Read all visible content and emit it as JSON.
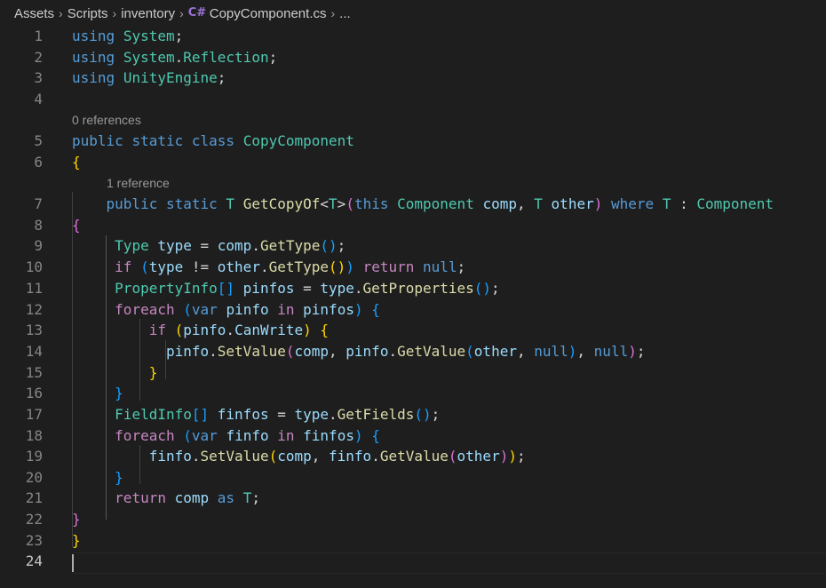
{
  "breadcrumb": {
    "items": [
      "Assets",
      "Scripts",
      "inventory"
    ],
    "file_icon": "C#",
    "file": "CopyComponent.cs",
    "tail": "..."
  },
  "icons": {
    "separator": "chevron-right-icon",
    "file": "csharp-file-icon"
  },
  "colors": {
    "background": "#1e1e1e",
    "keyword_control": "#c586c0",
    "keyword": "#569cd6",
    "type": "#4ec9b0",
    "method": "#dcdcaa",
    "variable": "#9cdcfe",
    "line_number": "#858585"
  },
  "codelens": {
    "class": "0 references",
    "method": "1 reference"
  },
  "active_line": "24",
  "lines": [
    {
      "n": "1",
      "tokens": [
        [
          "kb",
          "using"
        ],
        [
          "pn",
          " "
        ],
        [
          "ty",
          "System"
        ],
        [
          "pn",
          ";"
        ]
      ]
    },
    {
      "n": "2",
      "tokens": [
        [
          "kb",
          "using"
        ],
        [
          "pn",
          " "
        ],
        [
          "ty",
          "System"
        ],
        [
          "pn",
          "."
        ],
        [
          "ty",
          "Reflection"
        ],
        [
          "pn",
          ";"
        ]
      ]
    },
    {
      "n": "3",
      "tokens": [
        [
          "kb",
          "using"
        ],
        [
          "pn",
          " "
        ],
        [
          "ty",
          "UnityEngine"
        ],
        [
          "pn",
          ";"
        ]
      ]
    },
    {
      "n": "4",
      "tokens": []
    },
    {
      "n": "5",
      "tokens": [
        [
          "kb",
          "public"
        ],
        [
          "pn",
          " "
        ],
        [
          "kb",
          "static"
        ],
        [
          "pn",
          " "
        ],
        [
          "kb",
          "class"
        ],
        [
          "pn",
          " "
        ],
        [
          "ty",
          "CopyComponent"
        ]
      ]
    },
    {
      "n": "6",
      "tokens": [
        [
          "br1",
          "{"
        ]
      ]
    },
    {
      "n": "7",
      "tokens": [
        [
          "pn",
          "    "
        ],
        [
          "kb",
          "public"
        ],
        [
          "pn",
          " "
        ],
        [
          "kb",
          "static"
        ],
        [
          "pn",
          " "
        ],
        [
          "ty",
          "T"
        ],
        [
          "pn",
          " "
        ],
        [
          "fn",
          "GetCopyOf"
        ],
        [
          "pn",
          "<"
        ],
        [
          "ty",
          "T"
        ],
        [
          "pn",
          ">"
        ],
        [
          "br2",
          "("
        ],
        [
          "kb",
          "this"
        ],
        [
          "pn",
          " "
        ],
        [
          "ty",
          "Component"
        ],
        [
          "pn",
          " "
        ],
        [
          "vr",
          "comp"
        ],
        [
          "pn",
          ", "
        ],
        [
          "ty",
          "T"
        ],
        [
          "pn",
          " "
        ],
        [
          "vr",
          "other"
        ],
        [
          "br2",
          ")"
        ],
        [
          "pn",
          " "
        ],
        [
          "kb",
          "where"
        ],
        [
          "pn",
          " "
        ],
        [
          "ty",
          "T"
        ],
        [
          "pn",
          " : "
        ],
        [
          "ty",
          "Component"
        ]
      ]
    },
    {
      "n": "8",
      "tokens": [
        [
          "br2",
          "{"
        ]
      ]
    },
    {
      "n": "9",
      "tokens": [
        [
          "pn",
          "     "
        ],
        [
          "ty",
          "Type"
        ],
        [
          "pn",
          " "
        ],
        [
          "vr",
          "type"
        ],
        [
          "pn",
          " = "
        ],
        [
          "vr",
          "comp"
        ],
        [
          "pn",
          "."
        ],
        [
          "fn",
          "GetType"
        ],
        [
          "br3",
          "()"
        ],
        [
          "pn",
          ";"
        ]
      ]
    },
    {
      "n": "10",
      "tokens": [
        [
          "pn",
          "     "
        ],
        [
          "kw",
          "if"
        ],
        [
          "pn",
          " "
        ],
        [
          "br3",
          "("
        ],
        [
          "vr",
          "type"
        ],
        [
          "pn",
          " != "
        ],
        [
          "vr",
          "other"
        ],
        [
          "pn",
          "."
        ],
        [
          "fn",
          "GetType"
        ],
        [
          "br1",
          "()"
        ],
        [
          "br3",
          ")"
        ],
        [
          "pn",
          " "
        ],
        [
          "kw",
          "return"
        ],
        [
          "pn",
          " "
        ],
        [
          "kb",
          "null"
        ],
        [
          "pn",
          ";"
        ]
      ]
    },
    {
      "n": "11",
      "tokens": [
        [
          "pn",
          "     "
        ],
        [
          "ty",
          "PropertyInfo"
        ],
        [
          "br3",
          "[]"
        ],
        [
          "pn",
          " "
        ],
        [
          "vr",
          "pinfos"
        ],
        [
          "pn",
          " = "
        ],
        [
          "vr",
          "type"
        ],
        [
          "pn",
          "."
        ],
        [
          "fn",
          "GetProperties"
        ],
        [
          "br3",
          "()"
        ],
        [
          "pn",
          ";"
        ]
      ]
    },
    {
      "n": "12",
      "tokens": [
        [
          "pn",
          "     "
        ],
        [
          "kw",
          "foreach"
        ],
        [
          "pn",
          " "
        ],
        [
          "br3",
          "("
        ],
        [
          "kb",
          "var"
        ],
        [
          "pn",
          " "
        ],
        [
          "vr",
          "pinfo"
        ],
        [
          "pn",
          " "
        ],
        [
          "kw",
          "in"
        ],
        [
          "pn",
          " "
        ],
        [
          "vr",
          "pinfos"
        ],
        [
          "br3",
          ")"
        ],
        [
          "pn",
          " "
        ],
        [
          "br3",
          "{"
        ]
      ]
    },
    {
      "n": "13",
      "tokens": [
        [
          "pn",
          "         "
        ],
        [
          "kw",
          "if"
        ],
        [
          "pn",
          " "
        ],
        [
          "br1",
          "("
        ],
        [
          "vr",
          "pinfo"
        ],
        [
          "pn",
          "."
        ],
        [
          "vr",
          "CanWrite"
        ],
        [
          "br1",
          ")"
        ],
        [
          "pn",
          " "
        ],
        [
          "br1",
          "{"
        ]
      ]
    },
    {
      "n": "14",
      "tokens": [
        [
          "pn",
          "           "
        ],
        [
          "vr",
          "pinfo"
        ],
        [
          "pn",
          "."
        ],
        [
          "fn",
          "SetValue"
        ],
        [
          "br2",
          "("
        ],
        [
          "vr",
          "comp"
        ],
        [
          "pn",
          ", "
        ],
        [
          "vr",
          "pinfo"
        ],
        [
          "pn",
          "."
        ],
        [
          "fn",
          "GetValue"
        ],
        [
          "br3",
          "("
        ],
        [
          "vr",
          "other"
        ],
        [
          "pn",
          ", "
        ],
        [
          "kb",
          "null"
        ],
        [
          "br3",
          ")"
        ],
        [
          "pn",
          ", "
        ],
        [
          "kb",
          "null"
        ],
        [
          "br2",
          ")"
        ],
        [
          "pn",
          ";"
        ]
      ]
    },
    {
      "n": "15",
      "tokens": [
        [
          "pn",
          "         "
        ],
        [
          "br1",
          "}"
        ]
      ]
    },
    {
      "n": "16",
      "tokens": [
        [
          "pn",
          "     "
        ],
        [
          "br3",
          "}"
        ]
      ]
    },
    {
      "n": "17",
      "tokens": [
        [
          "pn",
          "     "
        ],
        [
          "ty",
          "FieldInfo"
        ],
        [
          "br3",
          "[]"
        ],
        [
          "pn",
          " "
        ],
        [
          "vr",
          "finfos"
        ],
        [
          "pn",
          " = "
        ],
        [
          "vr",
          "type"
        ],
        [
          "pn",
          "."
        ],
        [
          "fn",
          "GetFields"
        ],
        [
          "br3",
          "()"
        ],
        [
          "pn",
          ";"
        ]
      ]
    },
    {
      "n": "18",
      "tokens": [
        [
          "pn",
          "     "
        ],
        [
          "kw",
          "foreach"
        ],
        [
          "pn",
          " "
        ],
        [
          "br3",
          "("
        ],
        [
          "kb",
          "var"
        ],
        [
          "pn",
          " "
        ],
        [
          "vr",
          "finfo"
        ],
        [
          "pn",
          " "
        ],
        [
          "kw",
          "in"
        ],
        [
          "pn",
          " "
        ],
        [
          "vr",
          "finfos"
        ],
        [
          "br3",
          ")"
        ],
        [
          "pn",
          " "
        ],
        [
          "br3",
          "{"
        ]
      ]
    },
    {
      "n": "19",
      "tokens": [
        [
          "pn",
          "         "
        ],
        [
          "vr",
          "finfo"
        ],
        [
          "pn",
          "."
        ],
        [
          "fn",
          "SetValue"
        ],
        [
          "br1",
          "("
        ],
        [
          "vr",
          "comp"
        ],
        [
          "pn",
          ", "
        ],
        [
          "vr",
          "finfo"
        ],
        [
          "pn",
          "."
        ],
        [
          "fn",
          "GetValue"
        ],
        [
          "br2",
          "("
        ],
        [
          "vr",
          "other"
        ],
        [
          "br2",
          ")"
        ],
        [
          "br1",
          ")"
        ],
        [
          "pn",
          ";"
        ]
      ]
    },
    {
      "n": "20",
      "tokens": [
        [
          "pn",
          "     "
        ],
        [
          "br3",
          "}"
        ]
      ]
    },
    {
      "n": "21",
      "tokens": [
        [
          "pn",
          "     "
        ],
        [
          "kw",
          "return"
        ],
        [
          "pn",
          " "
        ],
        [
          "vr",
          "comp"
        ],
        [
          "pn",
          " "
        ],
        [
          "kb",
          "as"
        ],
        [
          "pn",
          " "
        ],
        [
          "ty",
          "T"
        ],
        [
          "pn",
          ";"
        ]
      ]
    },
    {
      "n": "22",
      "tokens": [
        [
          "br2",
          "}"
        ]
      ]
    },
    {
      "n": "23",
      "tokens": [
        [
          "br1",
          "}"
        ]
      ]
    },
    {
      "n": "24",
      "tokens": []
    }
  ]
}
